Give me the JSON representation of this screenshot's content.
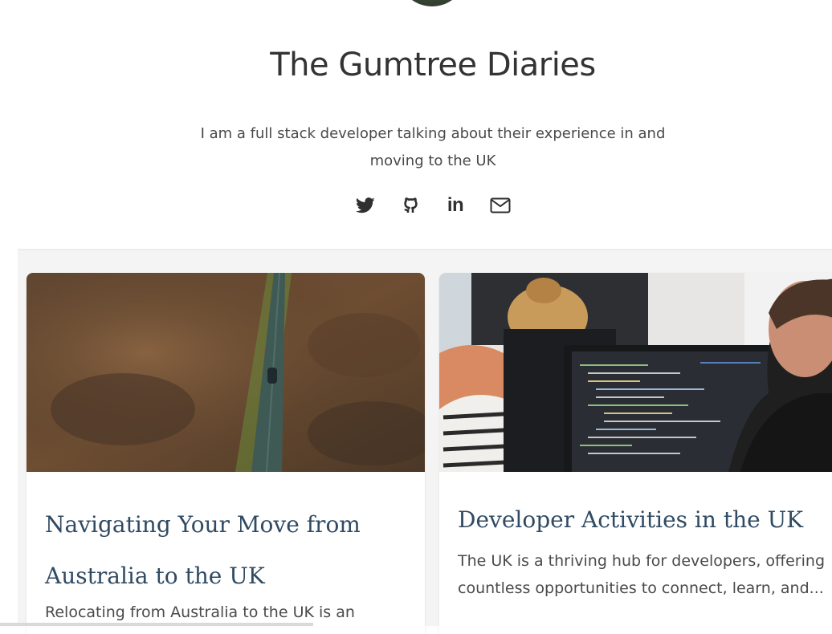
{
  "header": {
    "title": "The Gumtree Diaries",
    "tagline_line1": "I am a full stack developer talking about their experience in and",
    "tagline_line2": "moving to the UK",
    "social": [
      {
        "icon": "twitter-icon"
      },
      {
        "icon": "github-icon"
      },
      {
        "icon": "linkedin-icon",
        "text": "in"
      },
      {
        "icon": "envelope-icon"
      }
    ]
  },
  "posts": [
    {
      "title": "Navigating Your Move from Australia to the UK",
      "excerpt": "Relocating from Australia to the UK is an",
      "image": "aerial-road-through-moorland"
    },
    {
      "title": "Developer Activities in the UK",
      "excerpt": "The UK is a thriving hub for developers, offering countless opportunities to connect, learn, and...",
      "image": "developers-at-computer-screens"
    }
  ],
  "colors": {
    "title_text": "#333333",
    "post_title": "#2f4a63",
    "feed_background": "#f4f4f4"
  }
}
